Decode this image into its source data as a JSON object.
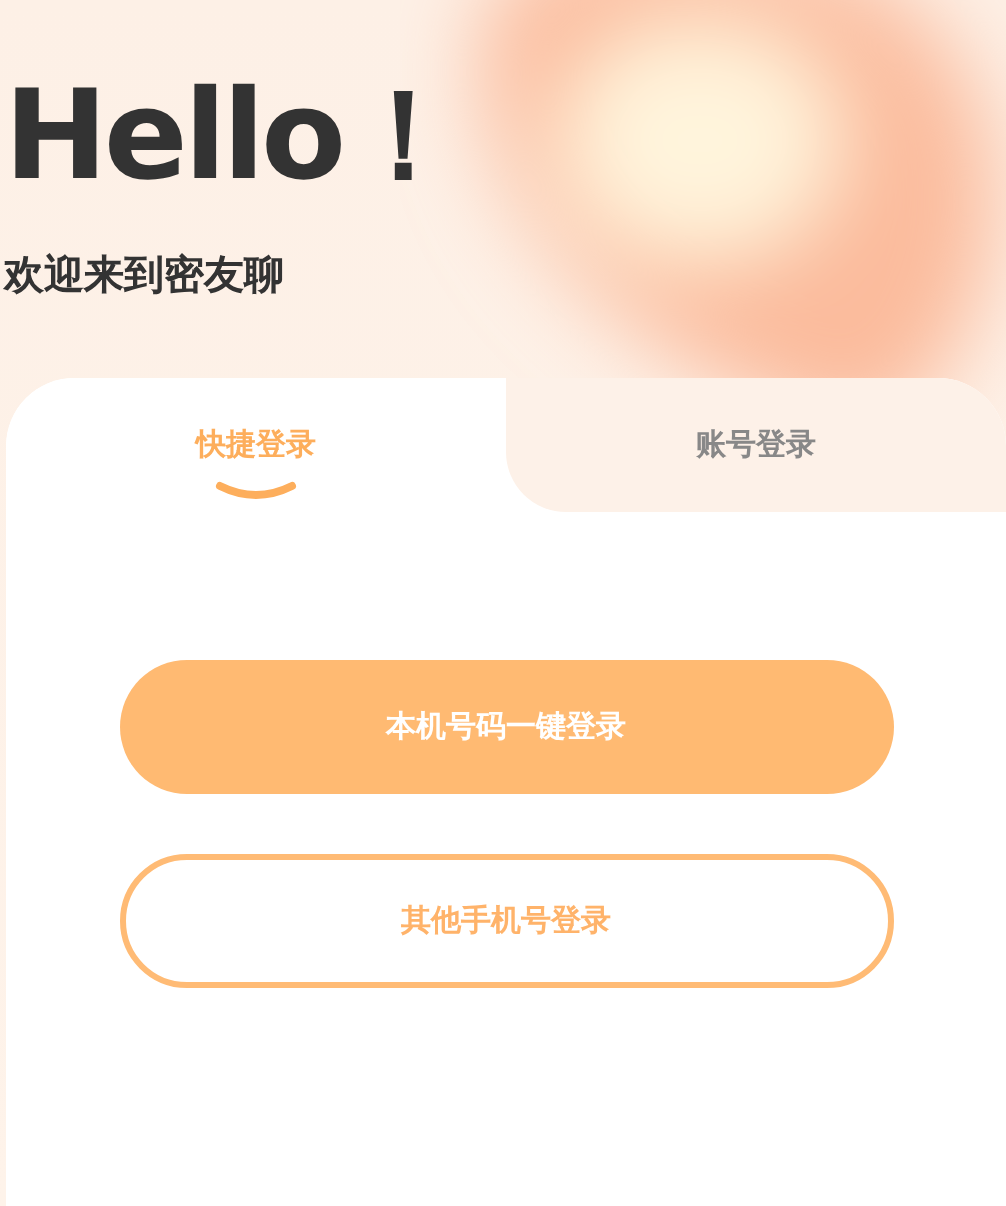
{
  "header": {
    "title": "Hello！",
    "subtitle": "欢迎来到密友聊"
  },
  "tabs": [
    {
      "label": "快捷登录",
      "selected": true
    },
    {
      "label": "账号登录",
      "selected": false
    }
  ],
  "buttons": [
    {
      "label": "本机号码一键登录",
      "kind": "primary"
    },
    {
      "label": "其他手机号登录",
      "kind": "outline"
    }
  ]
}
